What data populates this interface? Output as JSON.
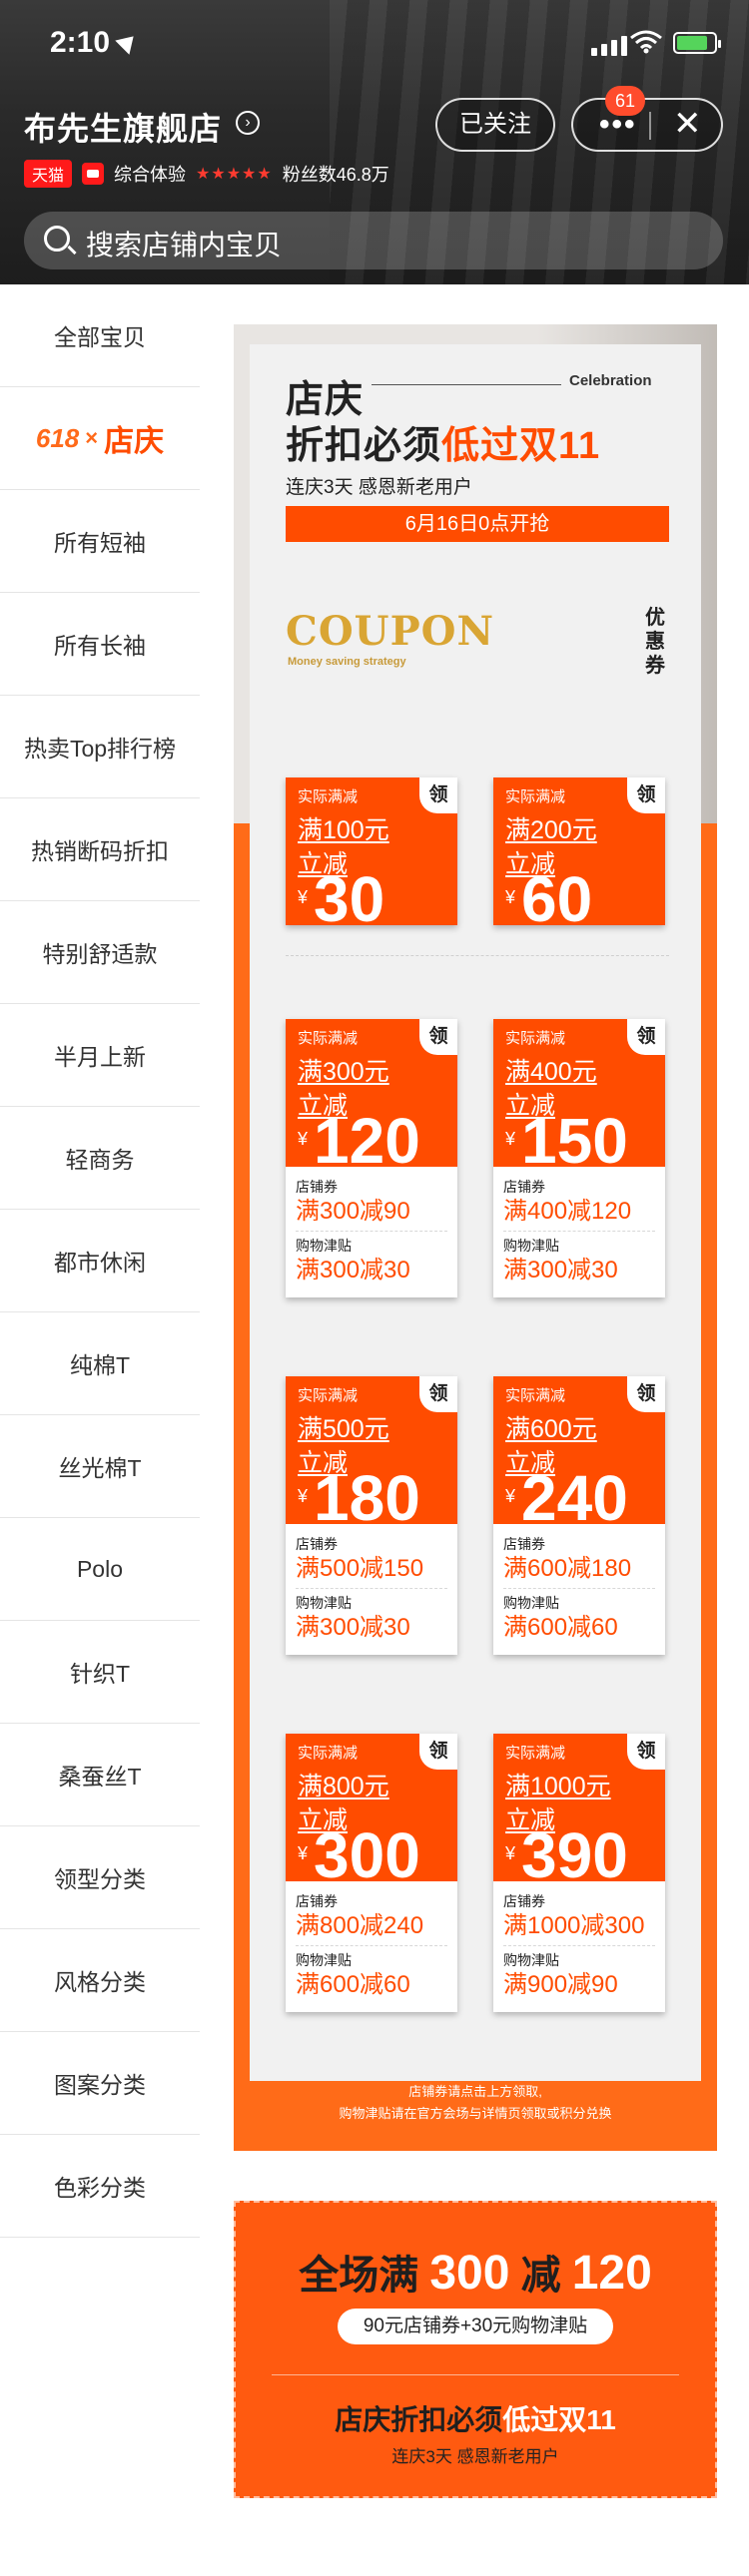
{
  "status_bar": {
    "time": "2:10"
  },
  "store": {
    "name": "布先生旗舰店",
    "follow_label": "已关注",
    "more_badge": "61",
    "tmall_tag": "天猫",
    "experience_label": "综合体验",
    "stars": "★★★★★",
    "fans": "粉丝数46.8万"
  },
  "search": {
    "placeholder": "搜索店铺内宝贝"
  },
  "sidebar": {
    "items": [
      {
        "label": "全部宝贝"
      },
      {
        "label_618": "618",
        "label_x": "×",
        "label": "店庆"
      },
      {
        "label": "所有短袖"
      },
      {
        "label": "所有长袖"
      },
      {
        "label": "热卖Top排行榜"
      },
      {
        "label": "热销断码折扣"
      },
      {
        "label": "特别舒适款"
      },
      {
        "label": "半月上新"
      },
      {
        "label": "轻商务"
      },
      {
        "label": "都市休闲"
      },
      {
        "label": "纯棉T"
      },
      {
        "label": "丝光棉T"
      },
      {
        "label": "Polo"
      },
      {
        "label": "针织T"
      },
      {
        "label": "桑蚕丝T"
      },
      {
        "label": "领型分类"
      },
      {
        "label": "风格分类"
      },
      {
        "label": "图案分类"
      },
      {
        "label": "色彩分类"
      }
    ]
  },
  "promo": {
    "headline_1": "店庆",
    "celebration": "Celebration",
    "headline_2_prefix": "折扣必须",
    "headline_2_hot": "低过双11",
    "subline": "连庆3天  感恩新老用户",
    "start_time": "6月16日0点开抢",
    "coupon_word": "COUPON",
    "coupon_sub": "Money saving strategy",
    "coupon_vertical": "优惠券",
    "coupon_kind": "实际满减",
    "coupon_ling": "领",
    "yen": "¥",
    "store_coupon_label": "店铺券",
    "subsidy_label": "购物津贴",
    "coupons": [
      {
        "cond": "满100元",
        "cut": "立减",
        "amount": "30"
      },
      {
        "cond": "满200元",
        "cut": "立减",
        "amount": "60"
      },
      {
        "cond": "满300元",
        "cut": "立减",
        "amount": "120",
        "store": "满300减90",
        "subsidy": "满300减30"
      },
      {
        "cond": "满400元",
        "cut": "立减",
        "amount": "150",
        "store": "满400减120",
        "subsidy": "满300减30"
      },
      {
        "cond": "满500元",
        "cut": "立减",
        "amount": "180",
        "store": "满500减150",
        "subsidy": "满300减30"
      },
      {
        "cond": "满600元",
        "cut": "立减",
        "amount": "240",
        "store": "满600减180",
        "subsidy": "满600减60"
      },
      {
        "cond": "满800元",
        "cut": "立减",
        "amount": "300",
        "store": "满800减240",
        "subsidy": "满600减60"
      },
      {
        "cond": "满1000元",
        "cut": "立减",
        "amount": "390",
        "store": "满1000减300",
        "subsidy": "满900减90"
      }
    ],
    "note_1": "店铺券请点击上方领取,",
    "note_2": "购物津贴请在官方会场与详情页领取或积分兑换"
  },
  "banner": {
    "title_prefix": "全场满",
    "title_num1": "300",
    "title_mid": "减",
    "title_num2": "120",
    "pill": "90元店铺券+30元购物津贴",
    "h2_prefix": "店庆折扣必须",
    "h2_hot": "低过双11",
    "sub": "连庆3天  感恩新老用户"
  },
  "colors": {
    "accent": "#ff4c00",
    "gold": "#d9a534",
    "tmall": "#ff1a1a"
  }
}
